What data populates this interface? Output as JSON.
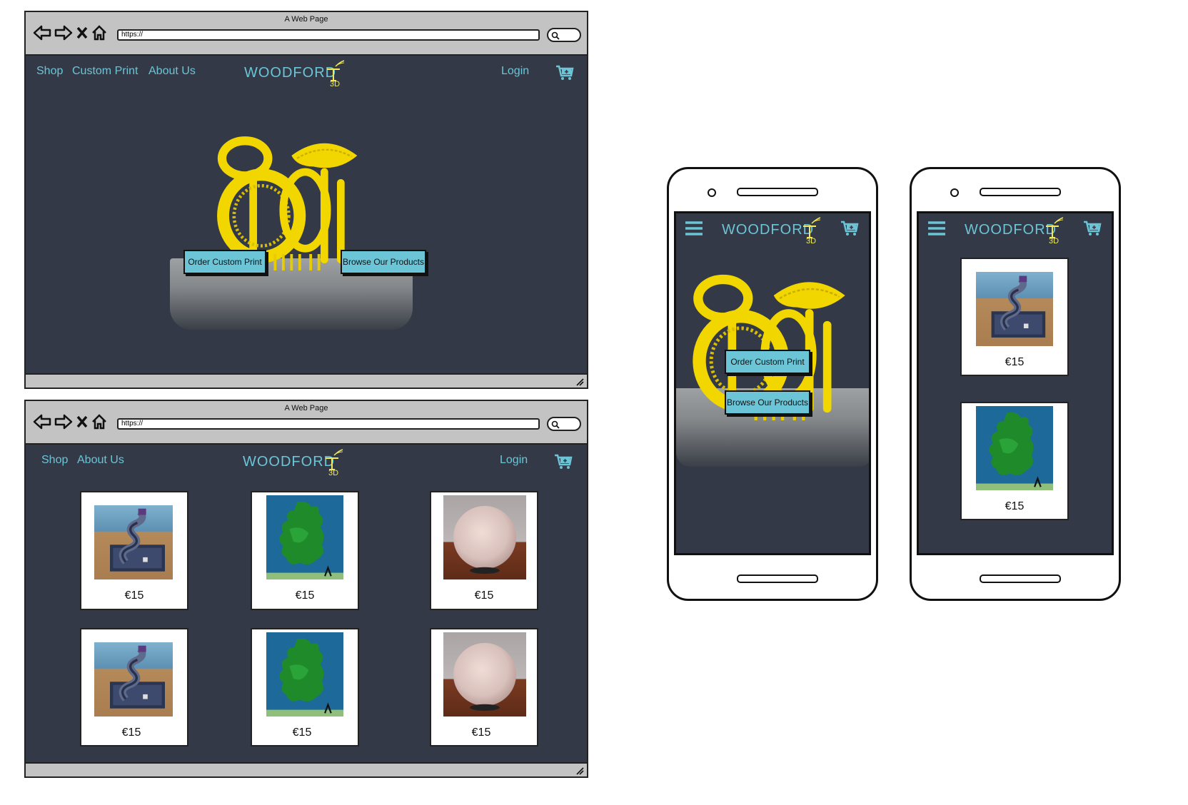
{
  "browser": {
    "window_title": "A Web Page",
    "url": "https://"
  },
  "brand": {
    "logo_text": "WOODFORD",
    "logo_badge": "3D"
  },
  "home_page": {
    "nav": {
      "shop": "Shop",
      "custom_print": "Custom Print",
      "about_us": "About Us",
      "login": "Login"
    },
    "hero": {
      "order_button": "Order Custom Print",
      "browse_button": "Browse Our Products"
    }
  },
  "shop_page": {
    "nav": {
      "shop": "Shop",
      "about_us": "About Us",
      "login": "Login"
    },
    "products": [
      {
        "photo": "marble-run-spiral",
        "price": "€15"
      },
      {
        "photo": "ireland-map-relief",
        "price": "€15"
      },
      {
        "photo": "moon-lamp-sphere",
        "price": "€15"
      },
      {
        "photo": "marble-run-spiral",
        "price": "€15"
      },
      {
        "photo": "ireland-map-relief",
        "price": "€15"
      },
      {
        "photo": "moon-lamp-sphere",
        "price": "€15"
      }
    ]
  },
  "mobile_home": {
    "hero": {
      "order_button": "Order Custom Print",
      "browse_button": "Browse Our Products"
    }
  },
  "mobile_shop": {
    "products": [
      {
        "photo": "marble-run-spiral",
        "price": "€15"
      },
      {
        "photo": "ireland-map-relief",
        "price": "€15"
      }
    ]
  },
  "colors": {
    "accent": "#6cc5d6",
    "page_bg": "#333946",
    "chrome": "#c3c3c3",
    "yellow_print": "#f2d600"
  },
  "icons": [
    "back-arrow-icon",
    "forward-arrow-icon",
    "close-icon",
    "home-icon",
    "search-icon",
    "cart-icon",
    "hamburger-menu-icon",
    "resize-grip-icon"
  ]
}
